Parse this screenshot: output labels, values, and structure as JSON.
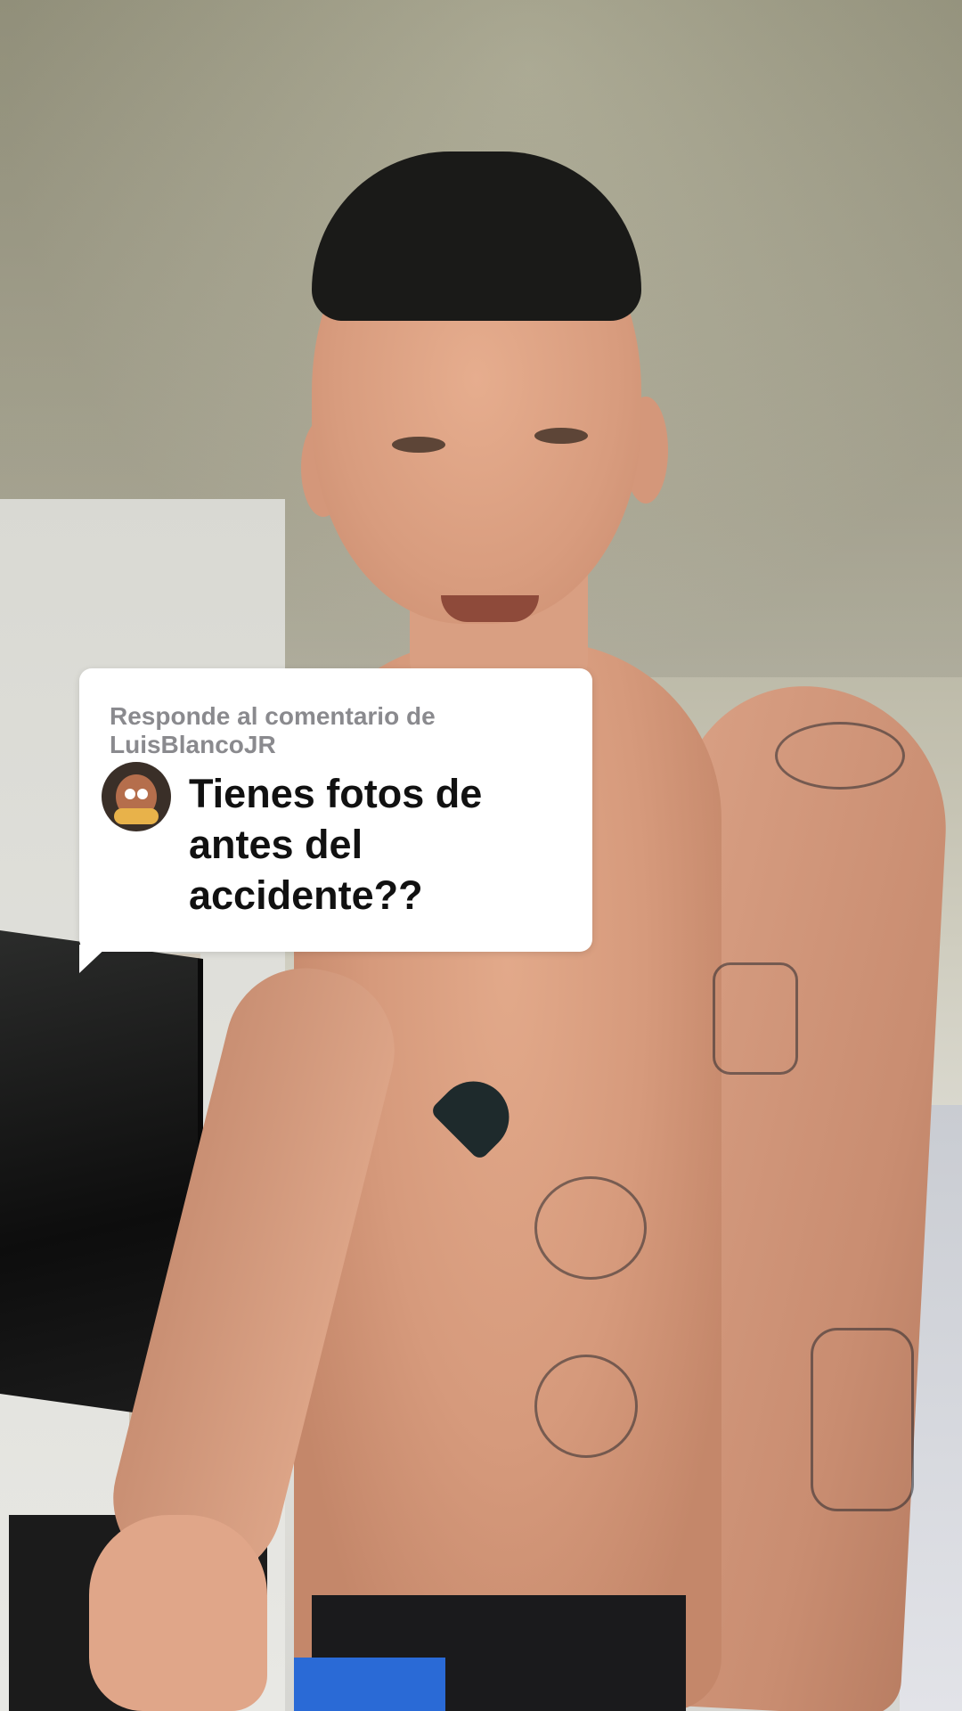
{
  "reply_card": {
    "header_line1": "Responde al comentario de",
    "header_line2": "LuisBlancoJR",
    "comment_line1": "Tienes fotos de",
    "comment_line2": "antes del",
    "comment_line3": "accidente??",
    "avatar_icon": "cartoon-avatar-icon"
  },
  "colors": {
    "bubble_bg": "#ffffff",
    "header_text": "#8a8a8e",
    "comment_text": "#111111"
  }
}
